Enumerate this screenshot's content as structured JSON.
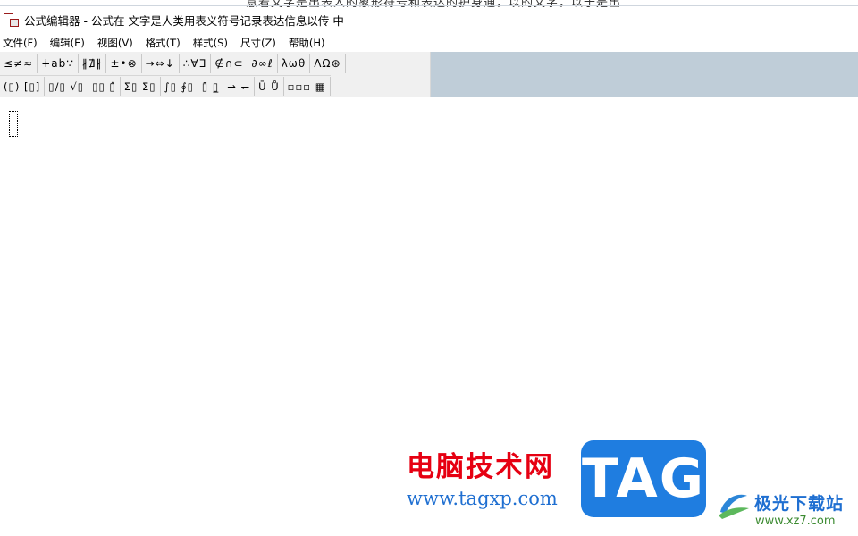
{
  "background_text": "意着文字是出表人的象形符号和表达的护身通，以的文字，以于是出",
  "window": {
    "title": "公式编辑器 - 公式在 文字是人类用表义符号记录表达信息以传 中"
  },
  "menu": [
    {
      "label": "文件(F)"
    },
    {
      "label": "编辑(E)"
    },
    {
      "label": "视图(V)"
    },
    {
      "label": "格式(T)"
    },
    {
      "label": "样式(S)"
    },
    {
      "label": "尺寸(Z)"
    },
    {
      "label": "帮助(H)"
    }
  ],
  "palette_row1": [
    {
      "label": "≤≠≈"
    },
    {
      "label": "∔ab∵"
    },
    {
      "label": "∦∄∦"
    },
    {
      "label": "±•⊗"
    },
    {
      "label": "→⇔↓"
    },
    {
      "label": "∴∀∃"
    },
    {
      "label": "∉∩⊂"
    },
    {
      "label": "∂∞ℓ"
    },
    {
      "label": "λωθ"
    },
    {
      "label": "ΛΩ⊛"
    }
  ],
  "palette_row2": [
    {
      "label": "(▯) [▯]"
    },
    {
      "label": "▯/▯ √▯"
    },
    {
      "label": "▯▯ ▯̂"
    },
    {
      "label": "Σ▯ Σ▯"
    },
    {
      "label": "∫▯ ∮▯"
    },
    {
      "label": "▯̄ ▯̲"
    },
    {
      "label": "⇀ ↽"
    },
    {
      "label": "Ū Ů"
    },
    {
      "label": "▫▫▫ ▦"
    }
  ],
  "watermark": {
    "brand_cn": "电脑技术网",
    "brand_url": "www.tagxp.com",
    "tag": "TAG",
    "site_cn": "极光下载站",
    "site_url": "www.xz7.com"
  },
  "colors": {
    "brand_red": "#e60012",
    "brand_blue": "#1f7de0",
    "toolbar_bg": "#bfcdd8"
  }
}
